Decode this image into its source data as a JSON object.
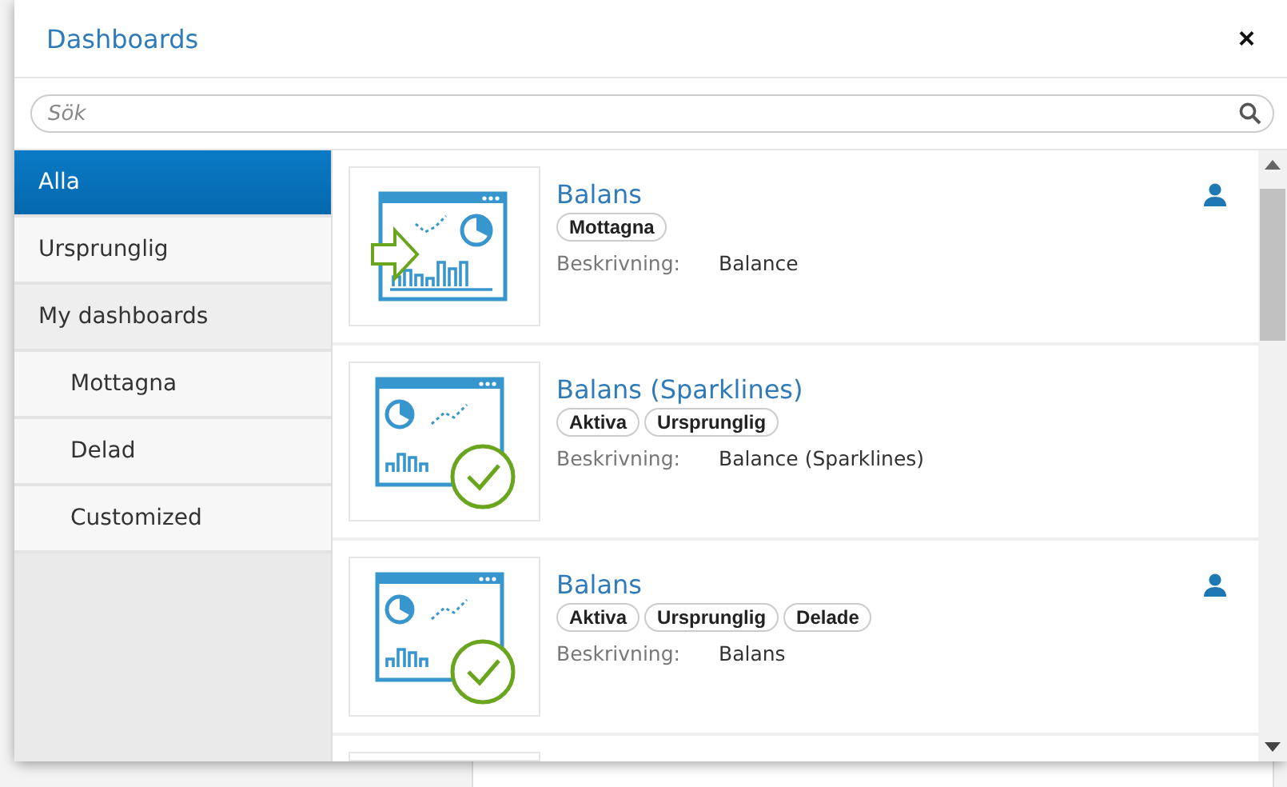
{
  "dialog": {
    "title": "Dashboards",
    "close": "×"
  },
  "search": {
    "placeholder": "Sök"
  },
  "sidebar": {
    "items": [
      {
        "label": "Alla",
        "selected": true
      },
      {
        "label": "Ursprunglig",
        "selected": false
      },
      {
        "label": "My dashboards",
        "selected": false,
        "children": [
          {
            "label": "Mottagna",
            "selected": false
          },
          {
            "label": "Delad",
            "selected": false
          },
          {
            "label": "Customized",
            "selected": false
          }
        ]
      }
    ]
  },
  "dashboards": [
    {
      "title": "Balans",
      "tags": [
        "Mottagna"
      ],
      "description_label": "Beskrivning:",
      "description": "Balance",
      "kind": "received",
      "owned": true
    },
    {
      "title": "Balans (Sparklines)",
      "tags": [
        "Aktiva",
        "Ursprunglig"
      ],
      "description_label": "Beskrivning:",
      "description": "Balance (Sparklines)",
      "kind": "active",
      "owned": false
    },
    {
      "title": "Balans",
      "tags": [
        "Aktiva",
        "Ursprunglig",
        "Delade"
      ],
      "description_label": "Beskrivning:",
      "description": "Balans",
      "kind": "active",
      "owned": true
    }
  ]
}
